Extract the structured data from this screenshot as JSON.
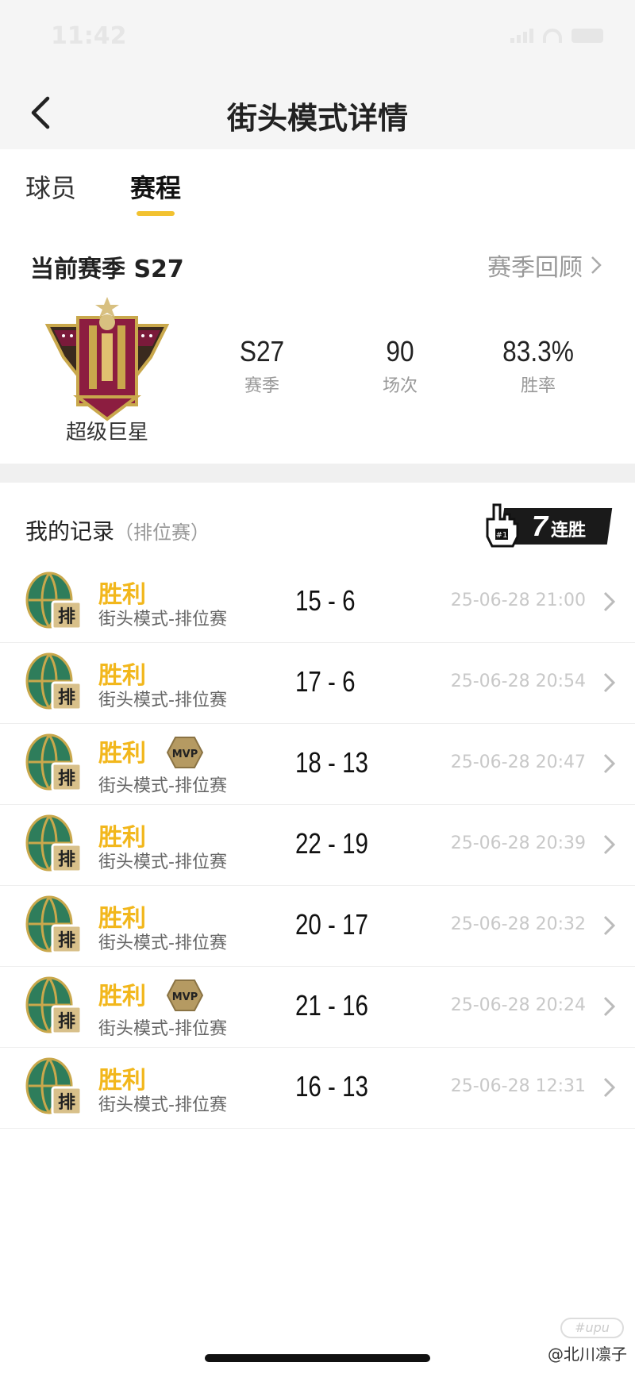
{
  "status_bar": {
    "time": "11:42"
  },
  "navbar": {
    "title": "街头模式详情",
    "back_icon": "chevron-left-icon"
  },
  "tabs": [
    {
      "label": "球员",
      "active": false
    },
    {
      "label": "赛程",
      "active": true
    }
  ],
  "season": {
    "title": "当前赛季 S27",
    "review_label": "赛季回顾",
    "rank_name": "超级巨星",
    "stats": [
      {
        "value": "S27",
        "label": "赛季"
      },
      {
        "value": "90",
        "label": "场次"
      },
      {
        "value": "83.3%",
        "label": "胜率"
      }
    ]
  },
  "records": {
    "title": "我的记录",
    "subtitle": "（排位赛）",
    "streak_count": "7",
    "streak_label": "连胜",
    "badge_text": "排",
    "mvp_text": "MVP",
    "items": [
      {
        "result": "胜利",
        "mode": "街头模式-排位赛",
        "score": "15 - 6",
        "date": "25-06-28 21:00",
        "mvp": false
      },
      {
        "result": "胜利",
        "mode": "街头模式-排位赛",
        "score": "17 - 6",
        "date": "25-06-28 20:54",
        "mvp": false
      },
      {
        "result": "胜利",
        "mode": "街头模式-排位赛",
        "score": "18 - 13",
        "date": "25-06-28 20:47",
        "mvp": true
      },
      {
        "result": "胜利",
        "mode": "街头模式-排位赛",
        "score": "22 - 19",
        "date": "25-06-28 20:39",
        "mvp": false
      },
      {
        "result": "胜利",
        "mode": "街头模式-排位赛",
        "score": "20 - 17",
        "date": "25-06-28 20:32",
        "mvp": false
      },
      {
        "result": "胜利",
        "mode": "街头模式-排位赛",
        "score": "21 - 16",
        "date": "25-06-28 20:24",
        "mvp": true
      },
      {
        "result": "胜利",
        "mode": "街头模式-排位赛",
        "score": "16 - 13",
        "date": "25-06-28 12:31",
        "mvp": false
      }
    ]
  },
  "watermark": {
    "logo": "#upu",
    "text": "@北川凛子"
  },
  "colors": {
    "accent": "#f2c230",
    "win": "#f2b71c",
    "badge_green": "#2e7d5b",
    "badge_gold": "#c9a84c"
  }
}
